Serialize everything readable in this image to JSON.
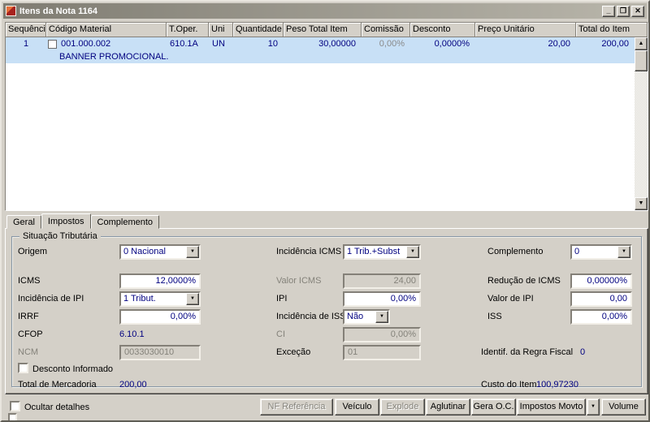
{
  "window": {
    "title": "Itens da Nota 1164"
  },
  "icons": {
    "minimize": "_",
    "maximize": "❐",
    "close": "✕",
    "dropdown": "▼",
    "scroll_up": "▲",
    "scroll_down": "▼"
  },
  "colors": {
    "accent_navy": "#000080",
    "row_selection": "#c8e0f6",
    "window_chrome": "#d4d0c8",
    "titlebar_gradient_from": "#7f7c72",
    "titlebar_gradient_to": "#b9b6ab"
  },
  "grid": {
    "columns": [
      "Sequência",
      "Código Material",
      "T.Oper.",
      "Uni",
      "Quantidade",
      "Peso Total Item",
      "Comissão",
      "Desconto",
      "Preço Unitário",
      "Total do Item"
    ],
    "row": {
      "sequencia": "1",
      "codigo": "001.000.002",
      "t_oper": "610.1A",
      "uni": "UN",
      "quantidade": "10",
      "peso": "30,00000",
      "comissao": "0,00%",
      "desconto": "0,0000%",
      "preco_unitario": "20,00",
      "total": "200,00",
      "descricao": "BANNER PROMOCIONAL."
    }
  },
  "tabs": {
    "geral": "Geral",
    "impostos": "Impostos",
    "complemento": "Complemento"
  },
  "form": {
    "group_title": "Situação Tributária",
    "origem": {
      "label": "Origem",
      "value": "0 Nacional"
    },
    "incidencia_icms": {
      "label": "Incidência ICMS",
      "value": "1 Trib.+Subst"
    },
    "complemento": {
      "label": "Complemento",
      "value": "0"
    },
    "icms": {
      "label": "ICMS",
      "value": "12,0000%"
    },
    "valor_icms": {
      "label": "Valor ICMS",
      "value": "24,00"
    },
    "reducao_icms": {
      "label": "Redução de ICMS",
      "value": "0,00000%"
    },
    "incidencia_ipi": {
      "label": "Incidência de IPI",
      "value": "1 Tribut."
    },
    "ipi": {
      "label": "IPI",
      "value": "0,00%"
    },
    "valor_ipi": {
      "label": "Valor de IPI",
      "value": "0,00"
    },
    "irrf": {
      "label": "IRRF",
      "value": "0,00%"
    },
    "incidencia_iss": {
      "label": "Incidência de ISS",
      "value": "Não"
    },
    "iss": {
      "label": "ISS",
      "value": "0,00%"
    },
    "cfop": {
      "label": "CFOP",
      "value": "6.10.1"
    },
    "ci": {
      "label": "CI",
      "value": "0,00%"
    },
    "ncm": {
      "label": "NCM",
      "value": "0033030010"
    },
    "excecao": {
      "label": "Exceção",
      "value": "01"
    },
    "identif_regra_fiscal": {
      "label": "Identif. da Regra Fiscal",
      "value": "0"
    },
    "desconto_informado": {
      "label": "Desconto Informado"
    },
    "total_mercadoria": {
      "label": "Total de Mercadoria",
      "value": "200,00"
    },
    "custo_item": {
      "label": "Custo do Item",
      "value": "100,97230"
    }
  },
  "footer": {
    "ocultar_detalhes": "Ocultar detalhes",
    "buttons": {
      "nf_referencia": "NF Referência",
      "veiculo": "Veículo",
      "explode": "Explode",
      "aglutinar": "Aglutinar",
      "gera_oc": "Gera O.C.",
      "impostos_movto": "Impostos Movto",
      "volume": "Volume"
    }
  }
}
